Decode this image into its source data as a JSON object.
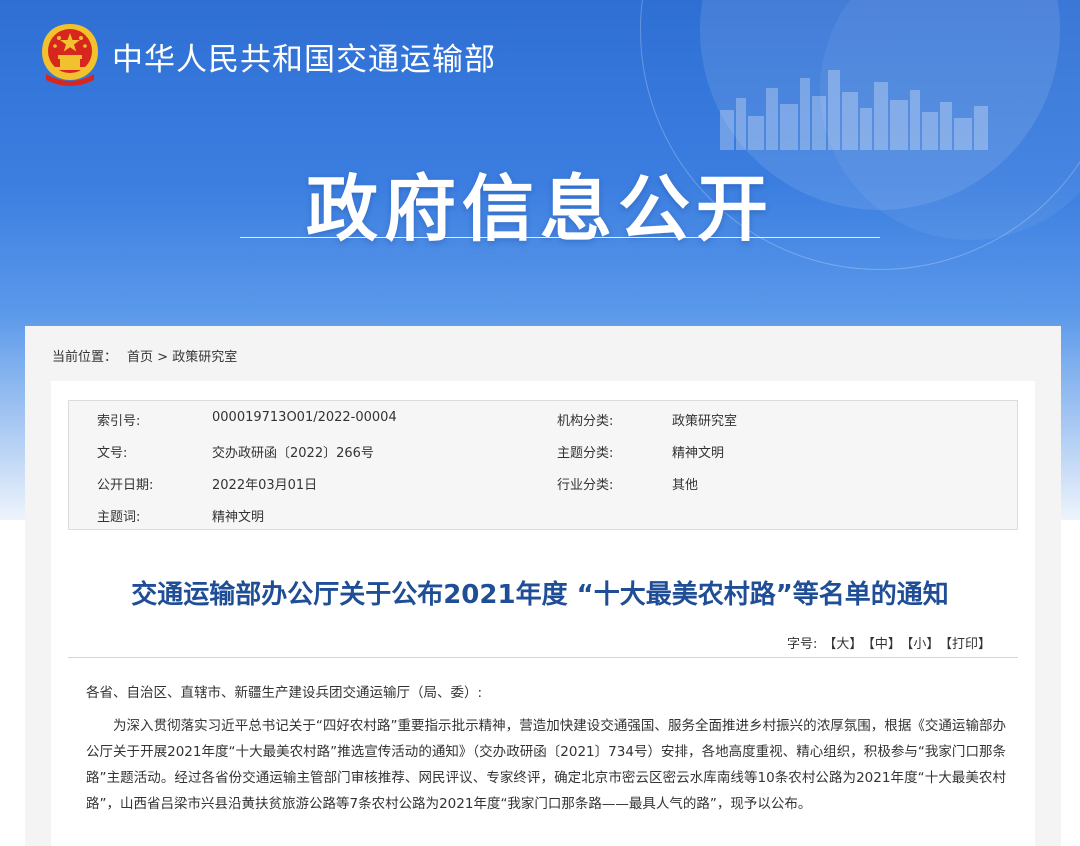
{
  "header": {
    "ministry_name": "中华人民共和国交通运输部",
    "banner_title": "政府信息公开"
  },
  "breadcrumb": {
    "label": "当前位置：",
    "home": "首页",
    "separator": ">",
    "current": "政策研究室"
  },
  "meta": {
    "index_label": "索引号:",
    "index_value": "000019713O01/2022-00004",
    "org_label": "机构分类:",
    "org_value": "政策研究室",
    "doc_label": "文号:",
    "doc_value": "交办政研函〔2022〕266号",
    "topic_label": "主题分类:",
    "topic_value": "精神文明",
    "date_label": "公开日期:",
    "date_value": "2022年03月01日",
    "industry_label": "行业分类:",
    "industry_value": "其他",
    "subject_label": "主题词:",
    "subject_value": "精神文明"
  },
  "article": {
    "title": "交通运输部办公厅关于公布2021年度 “十大最美农村路”等名单的通知",
    "font_size_label": "字号:",
    "font_large": "【大】",
    "font_medium": "【中】",
    "font_small": "【小】",
    "print": "【打印】",
    "salutation": "各省、自治区、直辖市、新疆生产建设兵团交通运输厅（局、委）:",
    "paragraph": "为深入贯彻落实习近平总书记关于“四好农村路”重要指示批示精神，营造加快建设交通强国、服务全面推进乡村振兴的浓厚氛围，根据《交通运输部办公厅关于开展2021年度“十大最美农村路”推选宣传活动的通知》（交办政研函〔2021〕734号）安排，各地高度重视、精心组织，积极参与“我家门口那条路”主题活动。经过各省份交通运输主管部门审核推荐、网民评议、专家终评，确定北京市密云区密云水库南线等10条农村公路为2021年度“十大最美农村路”，山西省吕梁市兴县沿黄扶贫旅游公路等7条农村公路为2021年度“我家门口那条路——最具人气的路”，现予以公布。"
  },
  "colors": {
    "banner_blue": "#3b7ee0",
    "title_blue": "#1f4e96",
    "emblem_red": "#d7261e",
    "emblem_gold": "#f2c12e"
  }
}
